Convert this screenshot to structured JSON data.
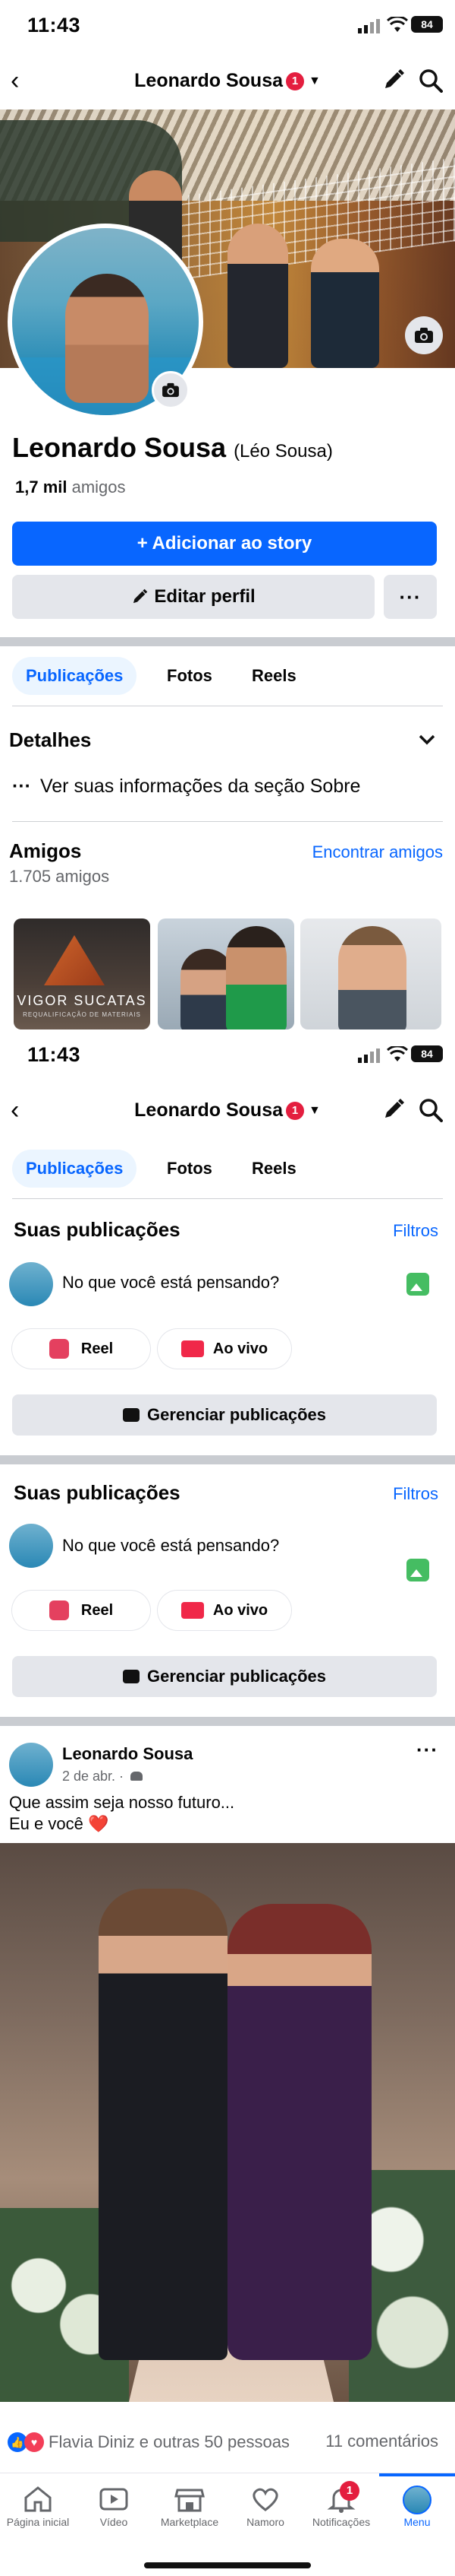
{
  "status": {
    "time": "11:43",
    "battery": "84"
  },
  "header": {
    "title": "Leonardo Sousa",
    "badge": "1"
  },
  "profile": {
    "name": "Leonardo Sousa",
    "alt_name": "(Léo Sousa)",
    "friends_count": "1,7 mil",
    "friends_label": "amigos",
    "add_story": "+ Adicionar ao story",
    "edit_profile": "Editar perfil",
    "more": "···"
  },
  "tabs": [
    "Publicações",
    "Fotos",
    "Reels"
  ],
  "details": {
    "title": "Detalhes",
    "about": "Ver suas informações da seção Sobre"
  },
  "friends_section": {
    "title": "Amigos",
    "count": "1.705 amigos",
    "find": "Encontrar amigos",
    "thumb1_text": "VIGOR SUCATAS",
    "thumb1_sub": "REQUALIFICAÇÃO DE MATERIAIS"
  },
  "posts_section": {
    "title": "Suas publicações",
    "filters": "Filtros",
    "composer": "No que você está pensando?",
    "reel": "Reel",
    "live": "Ao vivo",
    "manage": "Gerenciar publicações"
  },
  "post": {
    "author": "Leonardo Sousa",
    "date": "2 de abr. ·",
    "text_line1": "Que assim seja nosso futuro...",
    "text_line2": "Eu e você ❤️",
    "reactions": "Flavia Diniz e outras 50 pessoas",
    "comments": "11 comentários",
    "more": "···"
  },
  "bottom_nav": {
    "items": [
      "Página inicial",
      "Vídeo",
      "Marketplace",
      "Namoro",
      "Notificações",
      "Menu"
    ],
    "notif_badge": "1"
  },
  "colors": {
    "accent": "#0866ff",
    "badge": "#e41e3f",
    "secondary_bg": "#e4e6eb"
  }
}
